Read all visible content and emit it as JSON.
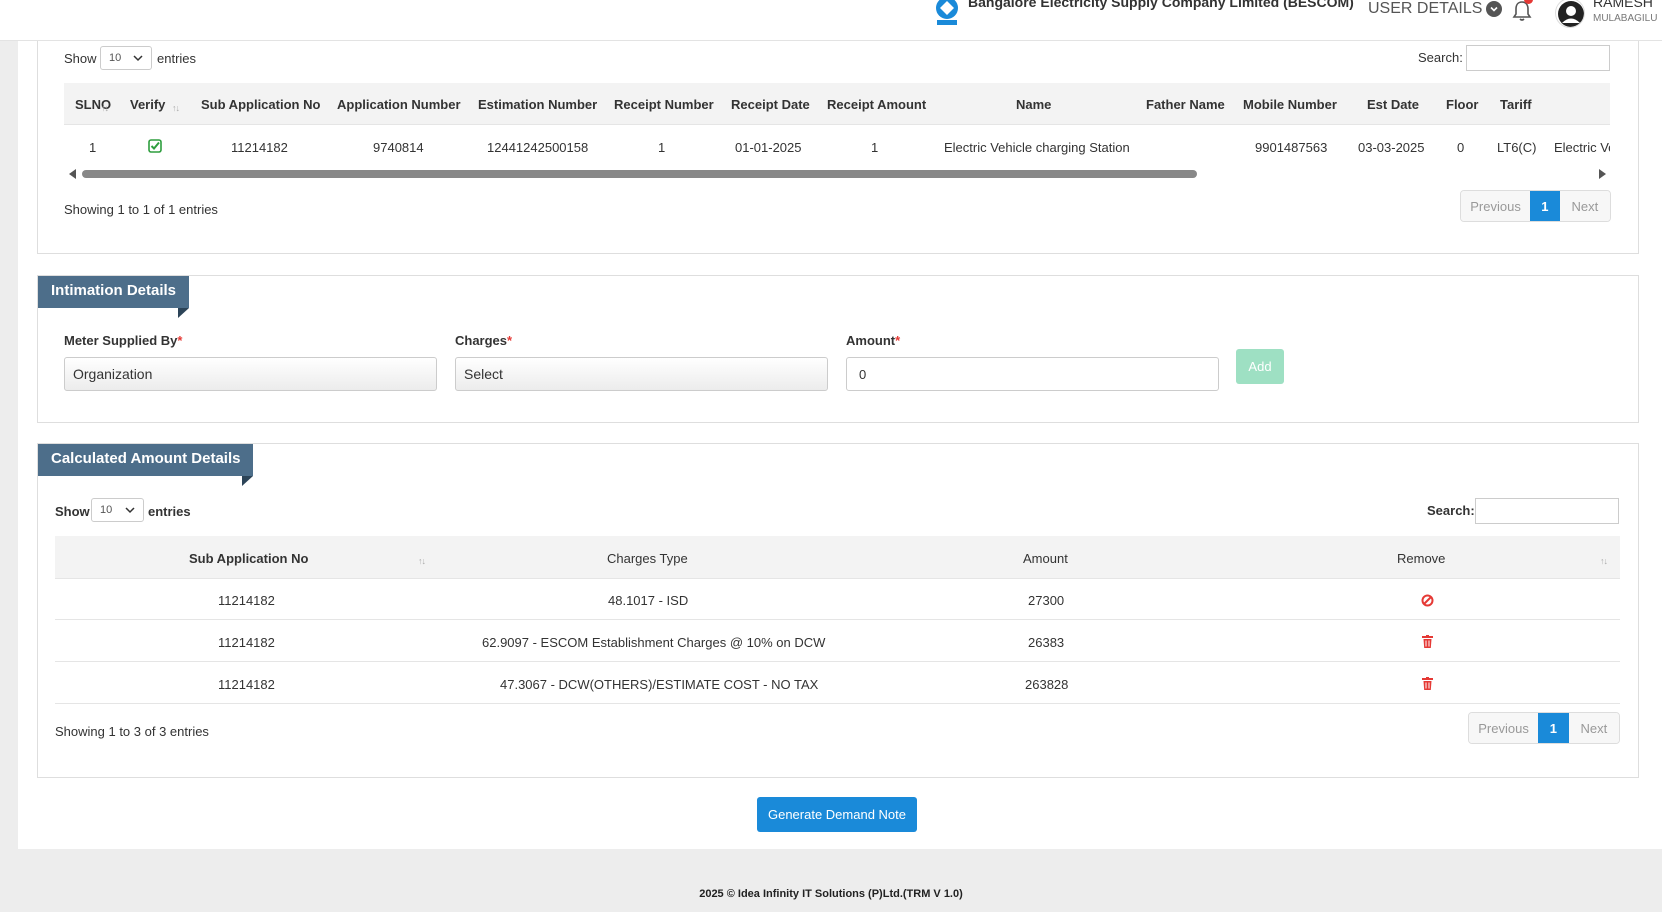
{
  "header": {
    "company": "Bangalore Electricity Supply Company Limited (BESCOM)",
    "logo_text": "BESCOM",
    "user_details_label": "USER DETAILS",
    "user_name": "RAMESH",
    "user_location": "MULABAGILU",
    "notification_color": "#e53935"
  },
  "applications_table": {
    "show_label": "Show",
    "entries_value": "10",
    "entries_label": "entries",
    "search_label": "Search:",
    "columns": [
      "SLNO",
      "Verify",
      "Sub Application No",
      "Application Number",
      "Estimation Number",
      "Receipt Number",
      "Receipt Date",
      "Receipt Amount",
      "Name",
      "Father Name",
      "Mobile Number",
      "Est Date",
      "Floor",
      "Tariff",
      ""
    ],
    "rows": [
      {
        "slno": "1",
        "verified": true,
        "sub_application_no": "11214182",
        "application_number": "9740814",
        "estimation_number": "12441242500158",
        "receipt_number": "1",
        "receipt_date": "01-01-2025",
        "receipt_amount": "1",
        "name": "Electric Vehicle charging Station",
        "father_name": "",
        "mobile_number": "9901487563",
        "est_date": "03-03-2025",
        "floor": "0",
        "tariff": "LT6(C)",
        "extra": "Electric Ve"
      }
    ],
    "info": "Showing 1 to 1 of 1 entries",
    "pagination": {
      "previous": "Previous",
      "current": "1",
      "next": "Next"
    }
  },
  "intimation": {
    "title": "Intimation Details",
    "meter_supplied_by_label": "Meter Supplied By",
    "meter_supplied_by_value": "Organization",
    "charges_label": "Charges",
    "charges_value": "Select",
    "amount_label": "Amount",
    "amount_value": "0",
    "required_mark": "*",
    "add_button": "Add"
  },
  "calculated": {
    "title": "Calculated Amount Details",
    "show_label": "Show",
    "entries_value": "10",
    "entries_label": "entries",
    "search_label": "Search:",
    "columns": [
      "Sub Application No",
      "Charges Type",
      "Amount",
      "Remove"
    ],
    "rows": [
      {
        "sub_application_no": "11214182",
        "charges_type": "48.1017 - ISD",
        "amount": "27300",
        "remove_icon": "ban-icon"
      },
      {
        "sub_application_no": "11214182",
        "charges_type": "62.9097 - ESCOM Establishment Charges @ 10% on DCW",
        "amount": "26383",
        "remove_icon": "trash-icon"
      },
      {
        "sub_application_no": "11214182",
        "charges_type": "47.3067 - DCW(OTHERS)/ESTIMATE COST - NO TAX",
        "amount": "263828",
        "remove_icon": "trash-icon"
      }
    ],
    "info": "Showing 1 to 3 of 3 entries",
    "pagination": {
      "previous": "Previous",
      "current": "1",
      "next": "Next"
    }
  },
  "generate_button": "Generate Demand Note",
  "footer": "2025 © Idea Infinity IT Solutions (P)Ltd.(TRM V 1.0)",
  "colors": {
    "primary": "#1a8ad9",
    "section_header": "#4d6e8a",
    "add_button": "#9ee0c3",
    "verify": "#2e9e3e",
    "danger": "#e53935"
  }
}
